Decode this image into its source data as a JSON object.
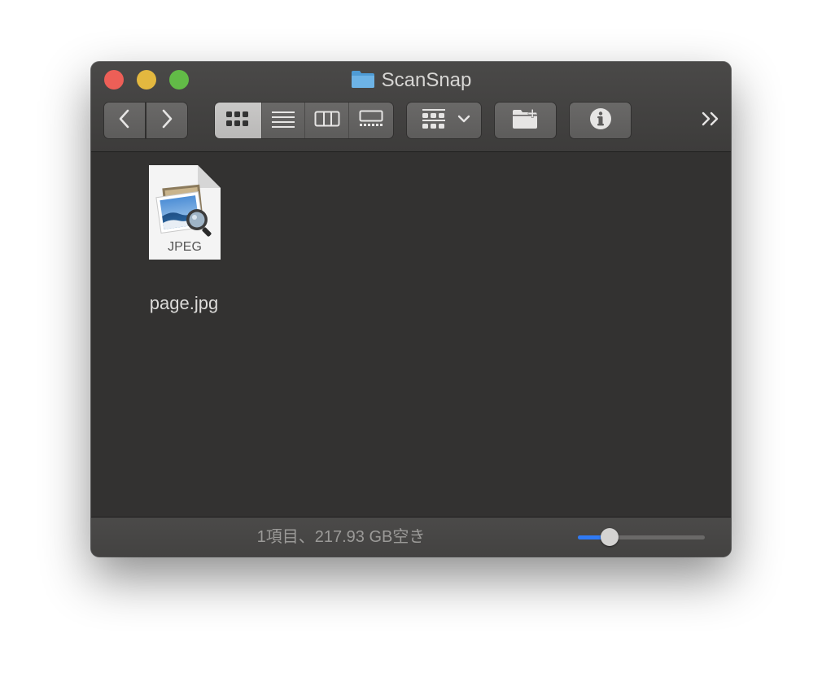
{
  "window": {
    "title": "ScanSnap",
    "icons": {
      "folder": "folder-icon"
    }
  },
  "toolbar": {
    "back": "chevron-left-icon",
    "forward": "chevron-right-icon",
    "view_modes": [
      {
        "name": "icon-view",
        "icon": "grid-icon",
        "active": true
      },
      {
        "name": "list-view",
        "icon": "list-icon",
        "active": false
      },
      {
        "name": "column-view",
        "icon": "columns-icon",
        "active": false
      },
      {
        "name": "gallery-view",
        "icon": "gallery-icon",
        "active": false
      }
    ],
    "group_menu": "group-icon",
    "new_folder": "new-folder-icon",
    "info": "info-icon",
    "overflow_label": "»"
  },
  "files": [
    {
      "name": "page.jpg",
      "type_label": "JPEG",
      "icon": "jpeg-file-icon"
    }
  ],
  "status": {
    "text": "1項目、217.93 GB空き",
    "zoom_fraction": 0.25
  },
  "colors": {
    "close": "#ed5f57",
    "minimize": "#e3b83f",
    "zoom": "#62bb47",
    "accent": "#2f7af5"
  }
}
